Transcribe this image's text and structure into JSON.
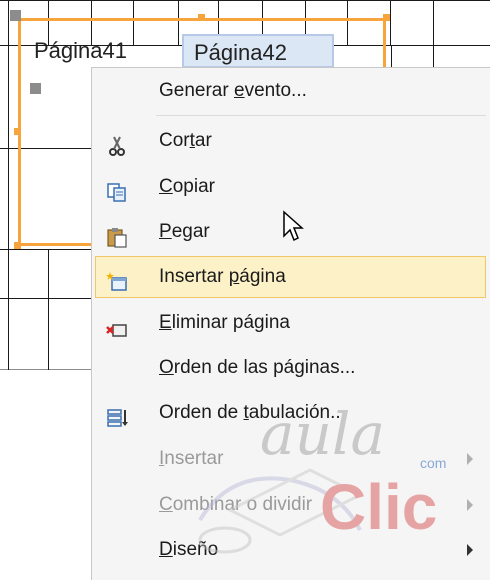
{
  "tabs": [
    "Página41",
    "Página42"
  ],
  "menu": {
    "items": [
      {
        "label_pre": "Generar ",
        "label_u": "e",
        "label_post": "vento...",
        "icon": "none",
        "disabled": false,
        "submenu": false
      },
      {
        "label_pre": "Cor",
        "label_u": "t",
        "label_post": "ar",
        "icon": "scissors-icon",
        "disabled": false,
        "submenu": false
      },
      {
        "label_pre": "",
        "label_u": "C",
        "label_post": "opiar",
        "icon": "copy-icon",
        "disabled": false,
        "submenu": false
      },
      {
        "label_pre": "",
        "label_u": "P",
        "label_post": "egar",
        "icon": "paste-icon",
        "disabled": false,
        "submenu": false
      },
      {
        "label_pre": "Insertar ",
        "label_u": "p",
        "label_post": "ágina",
        "icon": "insert-page-icon",
        "disabled": false,
        "submenu": false,
        "highlighted": true
      },
      {
        "label_pre": "",
        "label_u": "E",
        "label_post": "liminar página",
        "icon": "delete-page-icon",
        "disabled": false,
        "submenu": false
      },
      {
        "label_pre": "",
        "label_u": "O",
        "label_post": "rden de las páginas...",
        "icon": "none",
        "disabled": false,
        "submenu": false
      },
      {
        "label_pre": "Orden de ",
        "label_u": "t",
        "label_post": "abulación...",
        "icon": "tab-order-icon",
        "disabled": false,
        "submenu": false
      },
      {
        "label_pre": "",
        "label_u": "I",
        "label_post": "nsertar",
        "icon": "none",
        "disabled": true,
        "submenu": true
      },
      {
        "label_pre": "",
        "label_u": "C",
        "label_post": "ombinar o dividir",
        "icon": "none",
        "disabled": true,
        "submenu": true
      },
      {
        "label_pre": "",
        "label_u": "D",
        "label_post": "iseño",
        "icon": "none",
        "disabled": false,
        "submenu": true
      }
    ]
  },
  "watermark": {
    "line1": "aula",
    "line2": "Clic",
    "suffix": "com"
  },
  "colors": {
    "selection": "#f6a43b",
    "highlight_bg": "#fdf1c8",
    "highlight_border": "#f2c76a"
  }
}
